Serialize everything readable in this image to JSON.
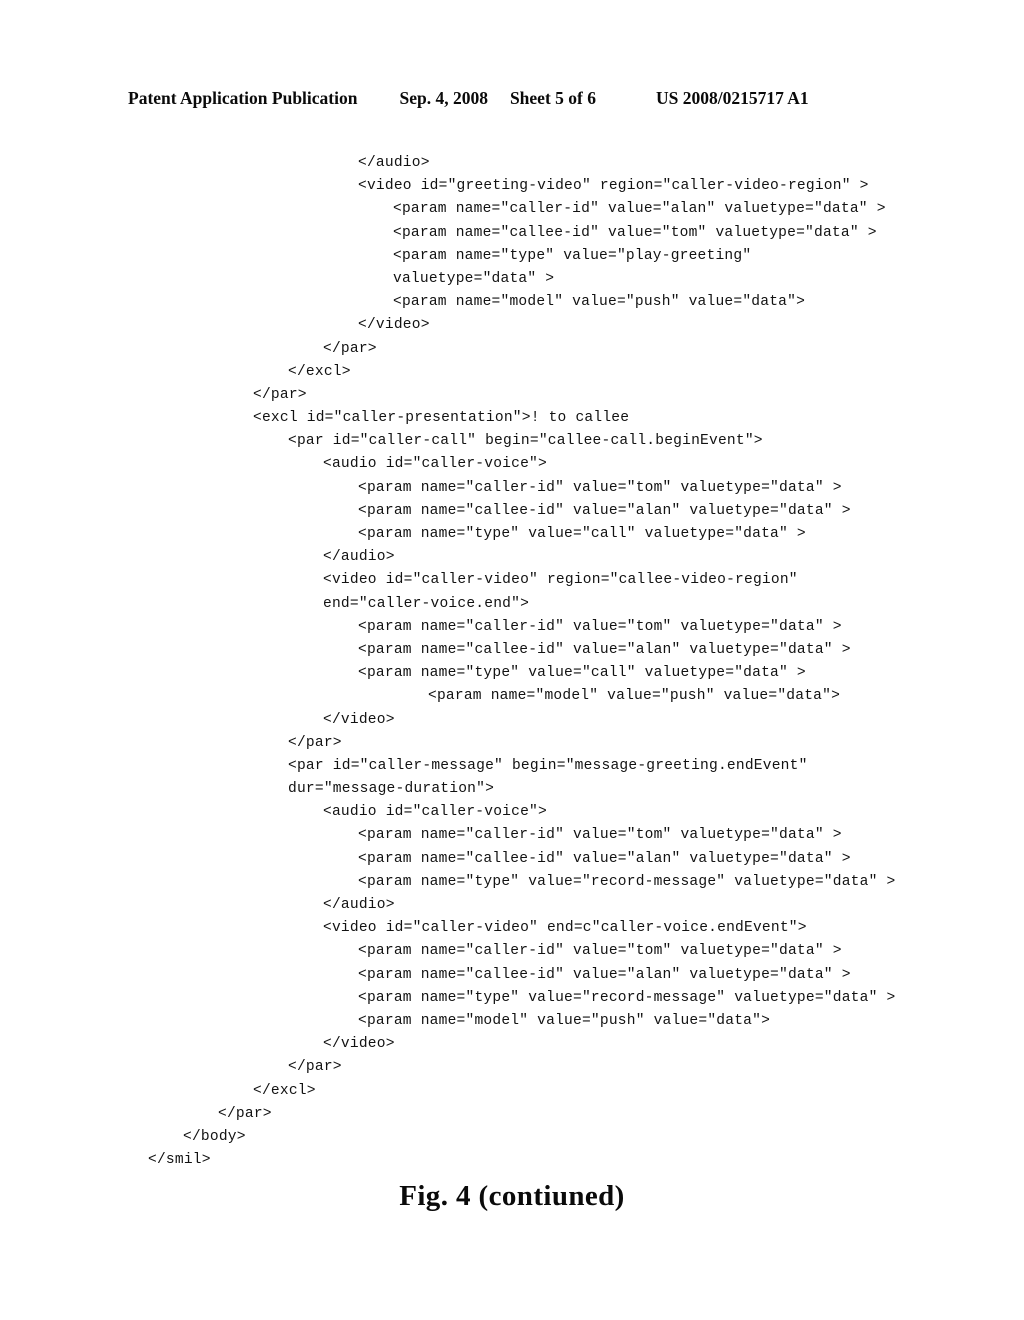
{
  "header": {
    "publication_label": "Patent Application Publication",
    "date": "Sep. 4, 2008",
    "sheet": "Sheet 5 of 6",
    "document_number": "US 2008/0215717 A1"
  },
  "listing": {
    "language": "smil",
    "lines": [
      {
        "indent": 6,
        "text": "</audio>"
      },
      {
        "indent": 6,
        "text": "<video id=\"greeting-video\" region=\"caller-video-region\" >"
      },
      {
        "indent": 7,
        "text": "<param name=\"caller-id\" value=\"alan\" valuetype=\"data\" >"
      },
      {
        "indent": 7,
        "text": "<param name=\"callee-id\" value=\"tom\" valuetype=\"data\" >"
      },
      {
        "indent": 7,
        "text": "<param name=\"type\" value=\"play-greeting\""
      },
      {
        "indent": 7,
        "text": "valuetype=\"data\" >"
      },
      {
        "indent": 7,
        "text": "<param name=\"model\" value=\"push\" value=\"data\">"
      },
      {
        "indent": 6,
        "text": "</video>"
      },
      {
        "indent": 5,
        "text": "</par>"
      },
      {
        "indent": 4,
        "text": "</excl>"
      },
      {
        "indent": 3,
        "text": "</par>"
      },
      {
        "indent": 3,
        "text": "<excl id=\"caller-presentation\">! to callee"
      },
      {
        "indent": 4,
        "text": "<par id=\"caller-call\" begin=\"callee-call.beginEvent\">"
      },
      {
        "indent": 5,
        "text": "<audio id=\"caller-voice\">"
      },
      {
        "indent": 6,
        "text": "<param name=\"caller-id\" value=\"tom\" valuetype=\"data\" >"
      },
      {
        "indent": 6,
        "text": "<param name=\"callee-id\" value=\"alan\" valuetype=\"data\" >"
      },
      {
        "indent": 6,
        "text": "<param name=\"type\" value=\"call\" valuetype=\"data\" >"
      },
      {
        "indent": 5,
        "text": "</audio>"
      },
      {
        "indent": 5,
        "text": "<video id=\"caller-video\" region=\"callee-video-region\""
      },
      {
        "indent": 5,
        "text": "end=\"caller-voice.end\">"
      },
      {
        "indent": 6,
        "text": "<param name=\"caller-id\" value=\"tom\" valuetype=\"data\" >"
      },
      {
        "indent": 6,
        "text": "<param name=\"callee-id\" value=\"alan\" valuetype=\"data\" >"
      },
      {
        "indent": 6,
        "text": "<param name=\"type\" value=\"call\" valuetype=\"data\" >"
      },
      {
        "indent": 8,
        "text": "<param name=\"model\" value=\"push\" value=\"data\">"
      },
      {
        "indent": 5,
        "text": "</video>"
      },
      {
        "indent": 4,
        "text": "</par>"
      },
      {
        "indent": 4,
        "text": "<par id=\"caller-message\" begin=\"message-greeting.endEvent\""
      },
      {
        "indent": 4,
        "text": "dur=\"message-duration\">"
      },
      {
        "indent": 5,
        "text": "<audio id=\"caller-voice\">"
      },
      {
        "indent": 6,
        "text": "<param name=\"caller-id\" value=\"tom\" valuetype=\"data\" >"
      },
      {
        "indent": 6,
        "text": "<param name=\"callee-id\" value=\"alan\" valuetype=\"data\" >"
      },
      {
        "indent": 6,
        "text": "<param name=\"type\" value=\"record-message\" valuetype=\"data\" >"
      },
      {
        "indent": 5,
        "text": "</audio>"
      },
      {
        "indent": 5,
        "text": "<video id=\"caller-video\" end=c\"caller-voice.endEvent\">"
      },
      {
        "indent": 6,
        "text": "<param name=\"caller-id\" value=\"tom\" valuetype=\"data\" >"
      },
      {
        "indent": 6,
        "text": "<param name=\"callee-id\" value=\"alan\" valuetype=\"data\" >"
      },
      {
        "indent": 6,
        "text": "<param name=\"type\" value=\"record-message\" valuetype=\"data\" >"
      },
      {
        "indent": 6,
        "text": "<param name=\"model\" value=\"push\" value=\"data\">"
      },
      {
        "indent": 5,
        "text": "</video>"
      },
      {
        "indent": 4,
        "text": "</par>"
      },
      {
        "indent": 3,
        "text": "</excl>"
      },
      {
        "indent": 2,
        "text": "</par>"
      },
      {
        "indent": 1,
        "text": "</body>"
      },
      {
        "indent": 0,
        "text": "</smil>"
      }
    ]
  },
  "figure": {
    "caption": "Fig. 4 (contiuned)"
  }
}
